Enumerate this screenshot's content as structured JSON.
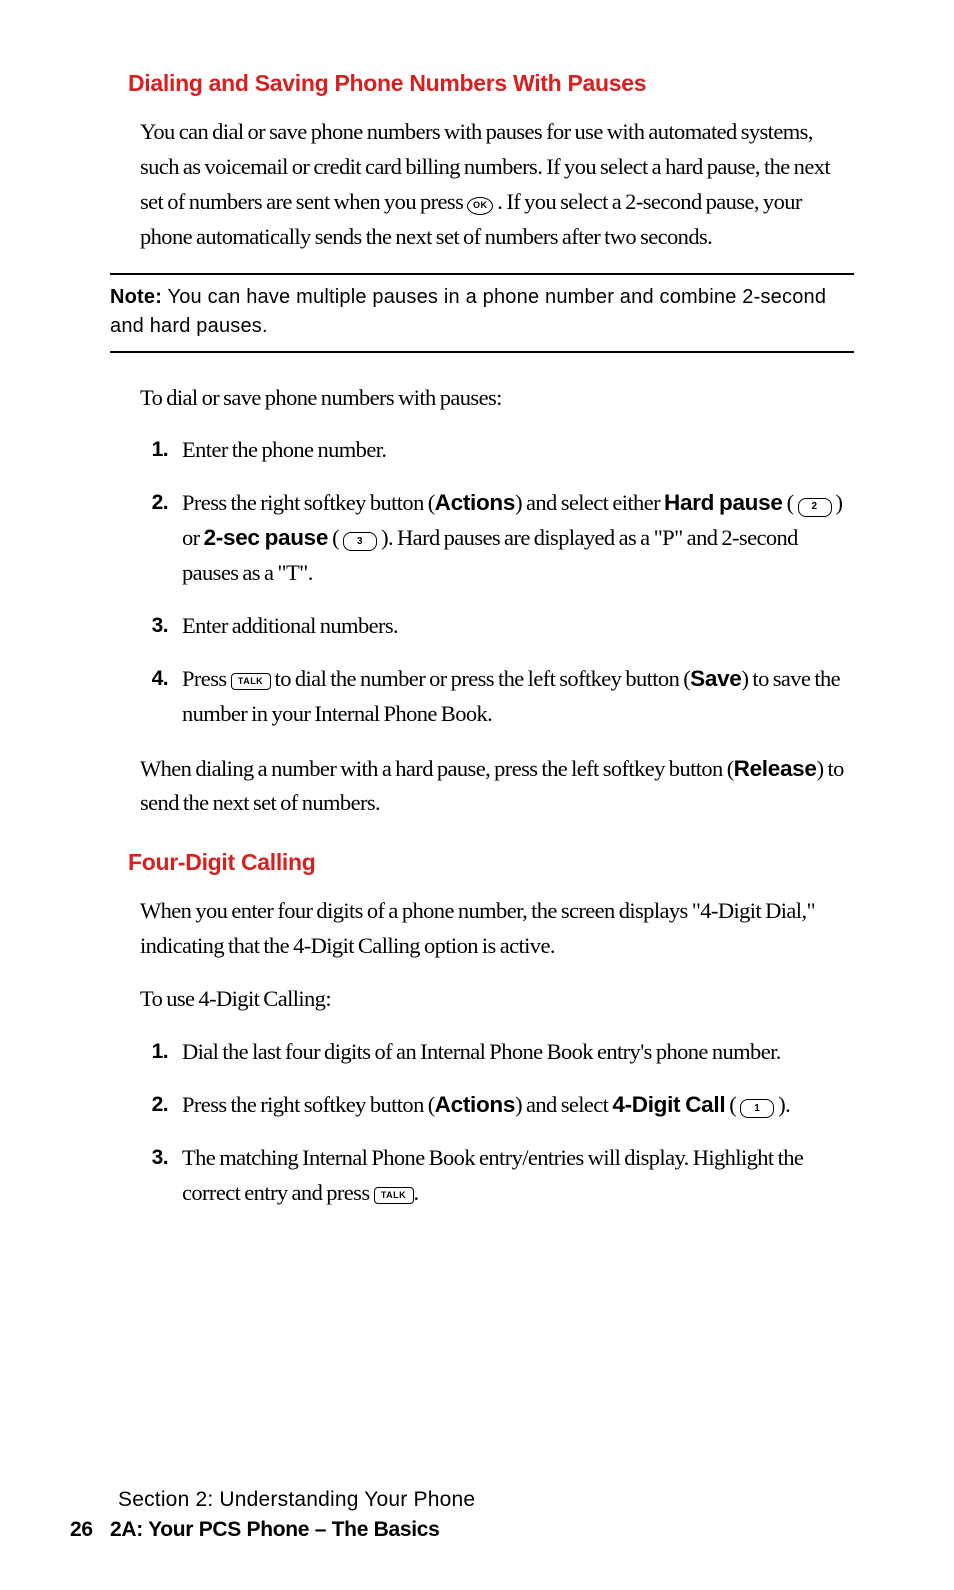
{
  "section1": {
    "heading": "Dialing and Saving Phone Numbers With Pauses",
    "p1a": "You can dial or save phone numbers with pauses for use with automated systems, such as voicemail or credit card billing numbers. If you select a hard pause, the next set of numbers are sent when you press ",
    "p1b": ". If you select a 2-second pause, your phone automatically sends the next set of numbers after two seconds.",
    "noteLabel": "Note:",
    "noteText": " You can have multiple pauses in a phone number and combine 2-second and hard pauses.",
    "p2": "To dial or save phone numbers with pauses:",
    "steps": {
      "n1": "1.",
      "s1": "Enter the phone number.",
      "n2": "2.",
      "s2a": "Press the right softkey button (",
      "s2b": "Actions",
      "s2c": ") and select either ",
      "s2d": "Hard pause",
      "s2e": " ( ",
      "s2f": " ) or ",
      "s2g": "2-sec pause",
      "s2h": " ( ",
      "s2i": " ). Hard pauses are displayed as a \"P\" and 2-second pauses as a \"T\".",
      "n3": "3.",
      "s3": "Enter additional numbers.",
      "n4": "4.",
      "s4a": "Press ",
      "s4b": " to dial the number or press the left softkey button (",
      "s4c": "Save",
      "s4d": ") to save the number in your Internal Phone Book."
    },
    "p3a": "When dialing a number with a hard pause, press the left softkey button (",
    "p3b": "Release",
    "p3c": ") to send the next set of numbers."
  },
  "section2": {
    "heading": "Four-Digit Calling",
    "p1": "When you enter four digits of a phone number, the screen displays \"4-Digit Dial,\" indicating that the 4-Digit Calling option is active.",
    "p2": "To use 4-Digit Calling:",
    "steps": {
      "n1": "1.",
      "s1": "Dial the last four digits of an Internal Phone Book entry's phone number.",
      "n2": "2.",
      "s2a": "Press the right softkey button (",
      "s2b": "Actions",
      "s2c": ") and select ",
      "s2d": "4-Digit Call",
      "s2e": " ( ",
      "s2f": " ).",
      "n3": "3.",
      "s3a": "The matching Internal Phone Book entry/entries will display. Highlight the correct entry and press ",
      "s3b": "."
    }
  },
  "keys": {
    "ok": "OK",
    "two": "2",
    "three": "3",
    "one": "1",
    "talk": "TALK"
  },
  "footer": {
    "section": "Section 2: Understanding Your Phone",
    "pageNum": "26",
    "chapter": "2A: Your PCS Phone – The Basics"
  }
}
